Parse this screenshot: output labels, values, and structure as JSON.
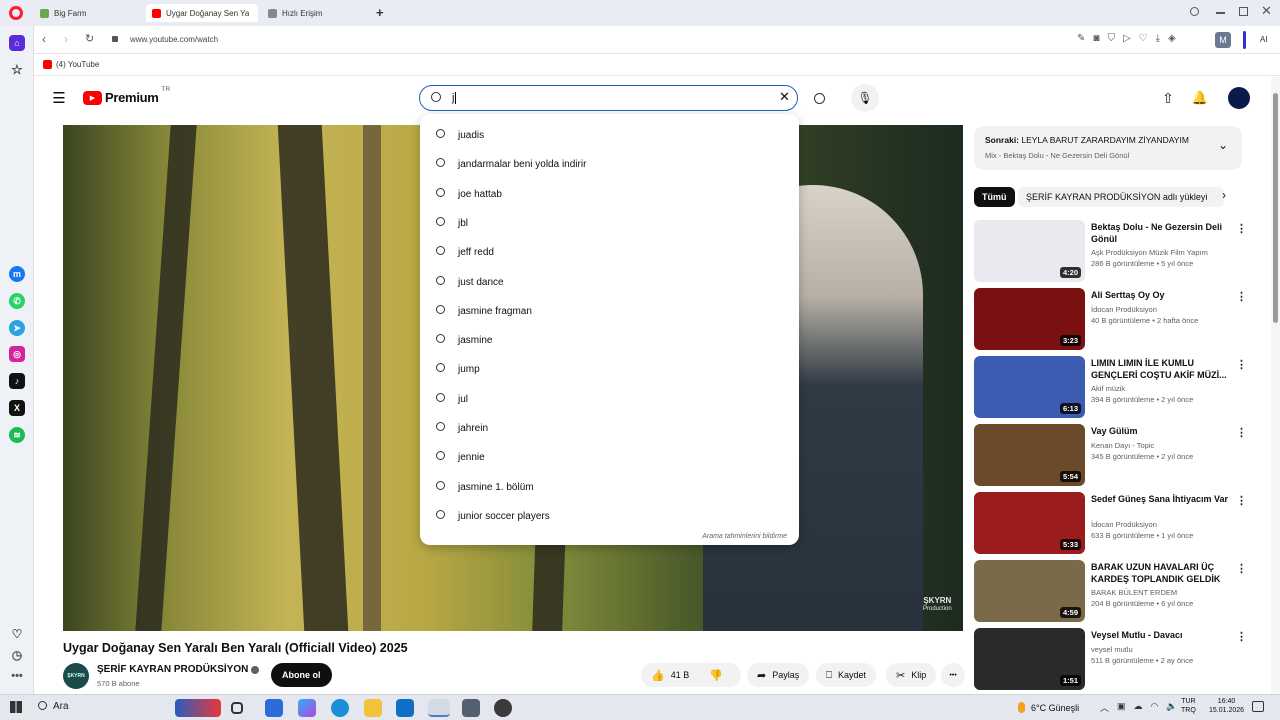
{
  "browser": {
    "tabs": [
      {
        "label": "Big Farm",
        "favicon_color": "#6aa84f"
      },
      {
        "label": "Uygar Doğanay Sen Ya",
        "favicon_color": "#ff0000",
        "active": true
      },
      {
        "label": "Hızlı Erişim",
        "favicon_color": "#888888"
      }
    ],
    "new_tab": "+",
    "url": "www.youtube.com/watch",
    "bookmark": "(4) YouTube",
    "profile_initial": "M",
    "ai_label": "AI"
  },
  "youtube": {
    "logo_text": "Premium",
    "region": "TR",
    "search_value": "j",
    "suggestions": [
      "juadis",
      "jandarmalar beni yolda indirir",
      "joe hattab",
      "jbl",
      "jeff redd",
      "just dance",
      "jasmine fragman",
      "jasmine",
      "jump",
      "jul",
      "jahrein",
      "jennie",
      "jasmine 1. bölüm",
      "junior soccer players"
    ],
    "report_text": "Arama tahminlerini bildirme",
    "video_watermark": "ŞKYRN",
    "video_watermark_sub": "Production",
    "video_title": "Uygar Doğanay Sen Yaralı Ben Yaralı (Officiall Video) 2025",
    "channel_name": "ŞERİF KAYRAN PRODÜKSİYON",
    "channel_avatar_text": "ŞKYRN",
    "subscribers": "570 B abone",
    "subscribe_label": "Abone ol",
    "like_count": "41 B",
    "share_label": "Paylaş",
    "save_label": "Kaydet",
    "clip_label": "Klip",
    "more_label": "•••",
    "up_next_prefix": "Sonraki:",
    "up_next_title": "LEYLA BARUT ZARARDAYIM ZİYANDAYIM",
    "up_next_sub": "Mix - Bektaş Dolu - Ne Gezersin Deli Gönül",
    "chips": [
      "Tümü",
      "ŞERİF KAYRAN PRODÜKSİYON adlı yükleyi"
    ],
    "recommendations": [
      {
        "title": "Bektaş Dolu - Ne Gezersin Deli Gönül",
        "channel": "Aşk Prodüksiyon Müzik Film Yapım",
        "meta": "286 B görüntüleme • 5 yıl önce",
        "duration": "4:20",
        "thumb": "#e8eaf0"
      },
      {
        "title": "Ali Serttaş Oy Oy",
        "channel": "İdocan Prodüksiyon",
        "meta": "40 B görüntüleme • 2 hafta önce",
        "duration": "3:23",
        "thumb": "#7a1010"
      },
      {
        "title": "LIMIN LIMIN İLE KUMLU GENÇLERİ COŞTU AKİF MÜZİ...",
        "channel": "Akif müzik",
        "meta": "394 B görüntüleme • 2 yıl önce",
        "duration": "6:13",
        "thumb": "#3b5cb0"
      },
      {
        "title": "Vay Gülüm",
        "channel": "Kenan Dayı - Topic",
        "meta": "345 B görüntüleme • 2 yıl önce",
        "duration": "5:54",
        "thumb": "#6a4a2a"
      },
      {
        "title": "Sedef Güneş Sana İhtiyacım Var",
        "channel": "İdocan Prodüksiyon",
        "meta": "633 B görüntüleme • 1 yıl önce",
        "duration": "5:33",
        "thumb": "#9b1c1c"
      },
      {
        "title": "BARAK UZUN HAVALARI ÜÇ KARDEŞ TOPLANDIK GELDİK ...",
        "channel": "BARAK BÜLENT ERDEM",
        "meta": "204 B görüntüleme • 6 yıl önce",
        "duration": "4:59",
        "thumb": "#7a6a4a"
      },
      {
        "title": "Veysel Mutlu - Davacı",
        "channel": "veysel mutlu",
        "meta": "511 B görüntüleme • 2 ay önce",
        "duration": "1:51",
        "thumb": "#2a2a2a"
      }
    ]
  },
  "taskbar": {
    "search_label": "Ara",
    "weather": "6°C Güneşli",
    "lang_top": "TUR",
    "lang_bottom": "TRQ",
    "time": "16:40",
    "date": "15.01.2026"
  },
  "colors": {
    "yt_red": "#ff0000",
    "accent_blue": "#1c62b9",
    "opera_red": "#ff1b2d"
  }
}
